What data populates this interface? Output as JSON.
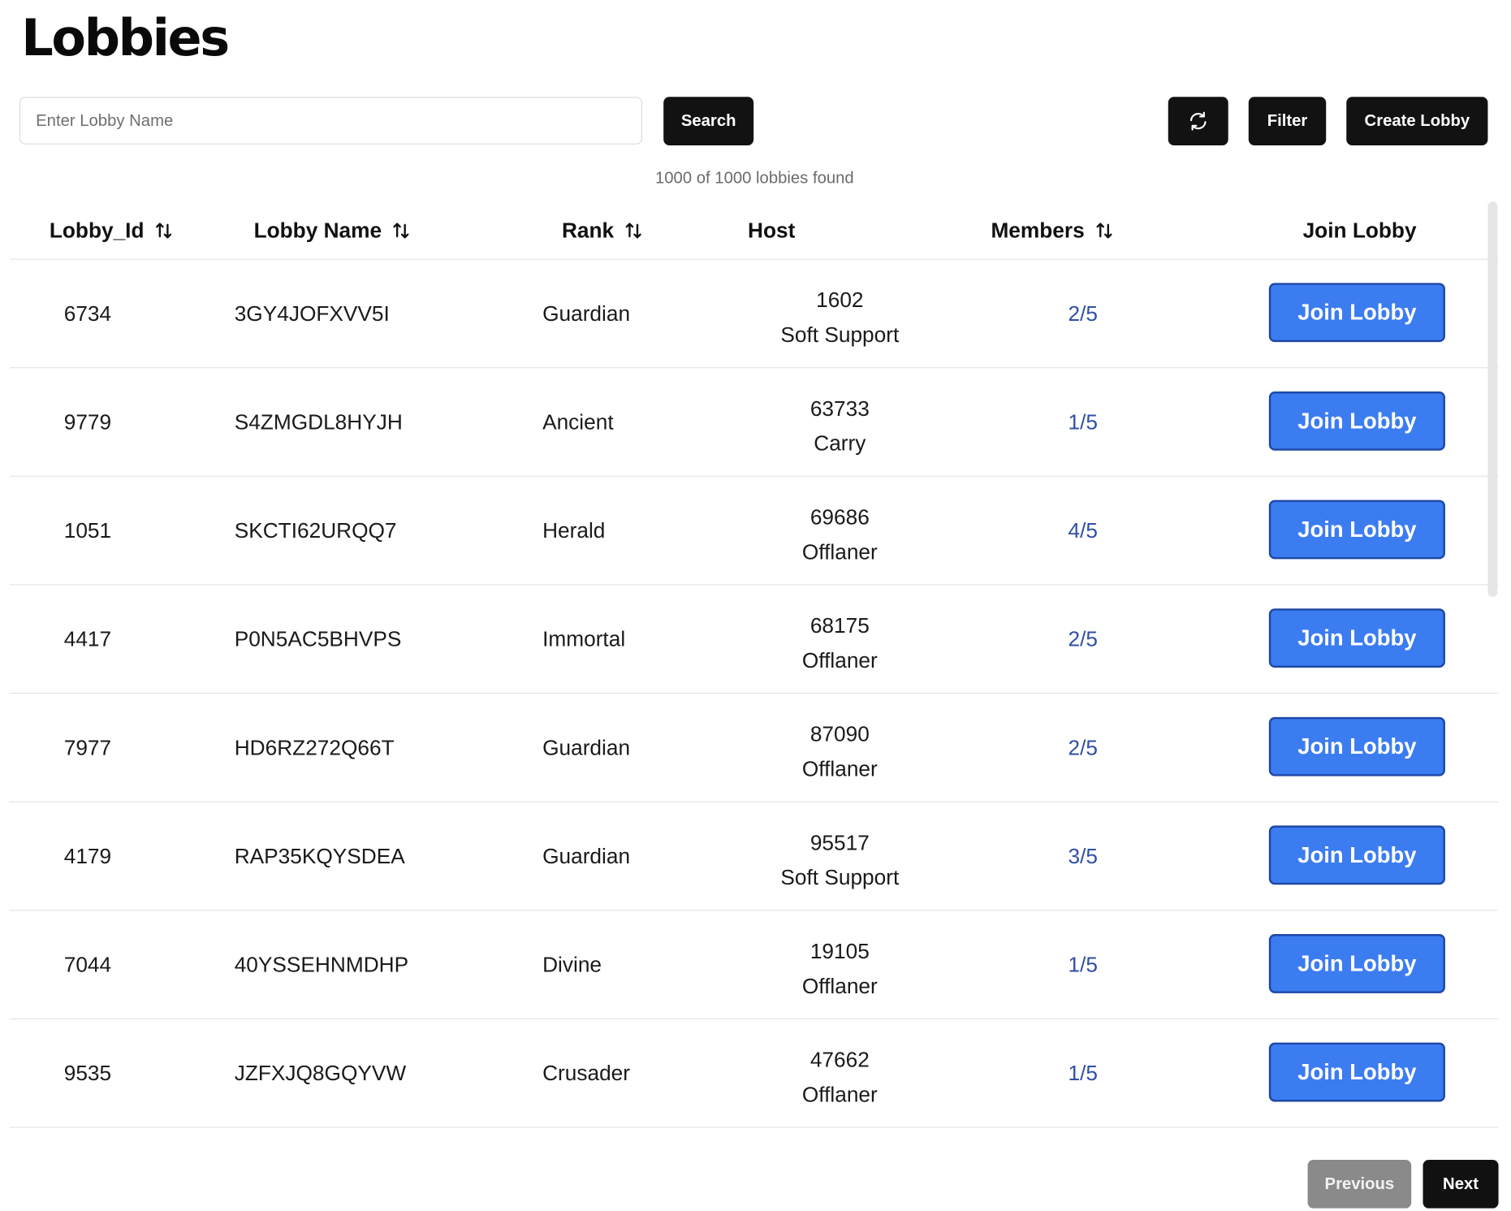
{
  "page": {
    "title": "Lobbies"
  },
  "toolbar": {
    "search_placeholder": "Enter Lobby Name",
    "search_value": "",
    "search_label": "Search",
    "refresh_icon": "refresh-icon",
    "filter_label": "Filter",
    "create_label": "Create Lobby"
  },
  "summary": {
    "result_count": "1000 of 1000 lobbies found"
  },
  "table": {
    "columns": [
      {
        "label": "Lobby_Id",
        "sortable": true
      },
      {
        "label": "Lobby Name",
        "sortable": true
      },
      {
        "label": "Rank",
        "sortable": true
      },
      {
        "label": "Host",
        "sortable": false
      },
      {
        "label": "Members",
        "sortable": true
      },
      {
        "label": "Join Lobby",
        "sortable": false
      }
    ],
    "sort_icon": "sort-arrows-icon",
    "rows": [
      {
        "id": "6734",
        "name": "3GY4JOFXVV5I",
        "rank": "Guardian",
        "host_id": "1602",
        "host_role": "Soft Support",
        "members": "2/5",
        "action": "Join Lobby"
      },
      {
        "id": "9779",
        "name": "S4ZMGDL8HYJH",
        "rank": "Ancient",
        "host_id": "63733",
        "host_role": "Carry",
        "members": "1/5",
        "action": "Join Lobby"
      },
      {
        "id": "1051",
        "name": "SKCTI62URQQ7",
        "rank": "Herald",
        "host_id": "69686",
        "host_role": "Offlaner",
        "members": "4/5",
        "action": "Join Lobby"
      },
      {
        "id": "4417",
        "name": "P0N5AC5BHVPS",
        "rank": "Immortal",
        "host_id": "68175",
        "host_role": "Offlaner",
        "members": "2/5",
        "action": "Join Lobby"
      },
      {
        "id": "7977",
        "name": "HD6RZ272Q66T",
        "rank": "Guardian",
        "host_id": "87090",
        "host_role": "Offlaner",
        "members": "2/5",
        "action": "Join Lobby"
      },
      {
        "id": "4179",
        "name": "RAP35KQYSDEA",
        "rank": "Guardian",
        "host_id": "95517",
        "host_role": "Soft Support",
        "members": "3/5",
        "action": "Join Lobby"
      },
      {
        "id": "7044",
        "name": "40YSSEHNMDHP",
        "rank": "Divine",
        "host_id": "19105",
        "host_role": "Offlaner",
        "members": "1/5",
        "action": "Join Lobby"
      },
      {
        "id": "9535",
        "name": "JZFXJQ8GQYVW",
        "rank": "Crusader",
        "host_id": "47662",
        "host_role": "Offlaner",
        "members": "1/5",
        "action": "Join Lobby"
      }
    ]
  },
  "pagination": {
    "previous_label": "Previous",
    "next_label": "Next",
    "previous_disabled": true
  },
  "colors": {
    "primary_dark": "#121212",
    "join_button": "#3b7cf0",
    "join_border": "#1d47a6",
    "members_text": "#2f4fa8",
    "disabled_button": "#8a8a8a"
  }
}
